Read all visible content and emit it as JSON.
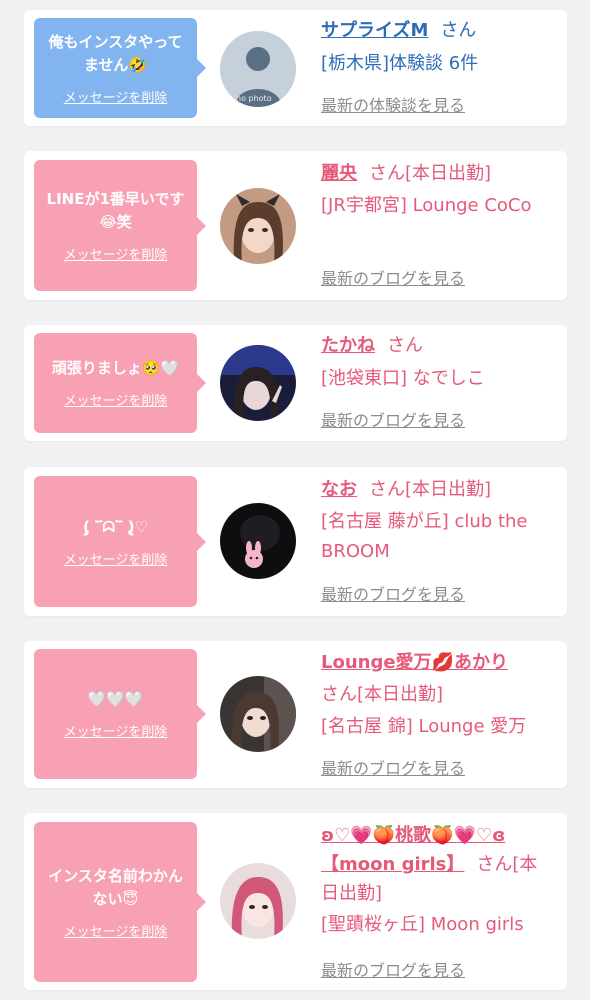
{
  "colors": {
    "blue_bubble": "#82b4ef",
    "pink_bubble": "#f8a1b5",
    "name_blue": "#2d6db5",
    "name_pink": "#e55a78",
    "link_grey": "#8c8c8c"
  },
  "cards": [
    {
      "message": "俺もインスタやってません🤣",
      "delete_label": "メッセージを削除",
      "name": "サプライズM",
      "suffix": "さん",
      "shop": "[栃木県]体験談 6件",
      "more_label": "最新の体験談を見る",
      "avatar": "no-photo",
      "avatar_text": "no photo"
    },
    {
      "message": "LINEが1番早いです😂笑",
      "delete_label": "メッセージを削除",
      "name": "麗央",
      "suffix": "さん[本日出勤]",
      "shop": "[JR宇都宮] Lounge CoCo",
      "more_label": "最新のブログを見る",
      "avatar": "girl-photo"
    },
    {
      "message": "頑張りましょ🥺🤍",
      "delete_label": "メッセージを削除",
      "name": "たかね",
      "suffix": "さん",
      "shop": "[池袋東口] なでしこ",
      "more_label": "最新のブログを見る",
      "avatar": "girl-photo"
    },
    {
      "message": "(̨̡ ‾᷄ᗣ‾᷅ )̧̢♡",
      "delete_label": "メッセージを削除",
      "name": "なお",
      "suffix": "さん[本日出勤]",
      "shop": "[名古屋 藤が丘] club the BROOM",
      "more_label": "最新のブログを見る",
      "avatar": "girl-photo"
    },
    {
      "message": "🤍🤍🤍",
      "delete_label": "メッセージを削除",
      "name": "Lounge愛万💋あかり",
      "suffix": "さん[本日出勤]",
      "shop": "[名古屋 錦] Lounge 愛万",
      "more_label": "最新のブログを見る",
      "avatar": "girl-photo"
    },
    {
      "message": "インスタ名前わかんない😇",
      "delete_label": "メッセージを削除",
      "name": "ʚ♡💗🍑桃歌🍑💗♡ɞ【moon girls】",
      "suffix": "さん[本日出勤]",
      "shop": "[聖蹟桜ヶ丘] Moon girls",
      "more_label": "最新のブログを見る",
      "avatar": "girl-photo"
    }
  ]
}
